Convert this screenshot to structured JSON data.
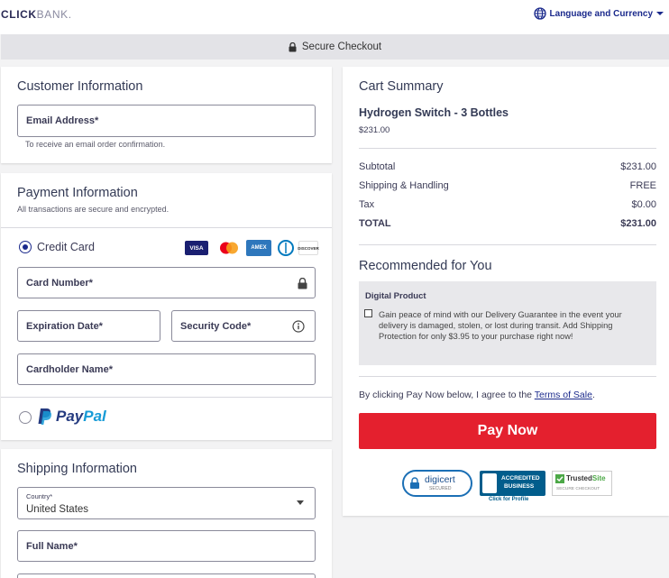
{
  "header": {
    "logo_strong": "CLICK",
    "logo_light": "BANK.",
    "language_label": "Language and Currency"
  },
  "secure_bar": {
    "label": "Secure Checkout"
  },
  "customer": {
    "title": "Customer Information",
    "email_label": "Email Address*",
    "email_hint": "To receive an email order confirmation."
  },
  "payment": {
    "title": "Payment Information",
    "subtitle": "All transactions are secure and encrypted.",
    "credit_card_label": "Credit Card",
    "card_logos": [
      "VISA",
      "MC",
      "AMEX",
      "DINERS",
      "DISCOVER"
    ],
    "card_number_label": "Card Number*",
    "expiration_label": "Expiration Date*",
    "security_code_label": "Security Code*",
    "cardholder_label": "Cardholder Name*",
    "paypal_pay": "Pay",
    "paypal_pal": "Pal"
  },
  "shipping": {
    "title": "Shipping Information",
    "country_label": "Country*",
    "country_value": "United States",
    "full_name_label": "Full Name*"
  },
  "cart": {
    "title": "Cart Summary",
    "product_name": "Hydrogen Switch - 3 Bottles",
    "product_price": "$231.00",
    "lines": [
      {
        "label": "Subtotal",
        "value": "$231.00"
      },
      {
        "label": "Shipping & Handling",
        "value": "FREE"
      },
      {
        "label": "Tax",
        "value": "$0.00"
      }
    ],
    "total_label": "TOTAL",
    "total_value": "$231.00",
    "recommended_title": "Recommended for You",
    "promo_tag": "Digital Product",
    "promo_text": "Gain peace of mind with our Delivery Guarantee in the event your delivery is damaged, stolen, or lost during transit. Add Shipping Protection for only $3.95 to your purchase right now!",
    "terms_prefix": "By clicking Pay Now below, I agree to the ",
    "terms_link": "Terms of Sale",
    "terms_suffix": ".",
    "pay_now": "Pay Now",
    "badges": {
      "digicert": "digicert",
      "digicert_sub": "SECURED",
      "bbb_line1": "ACCREDITED",
      "bbb_line2": "BUSINESS",
      "bbb_link": "Click for Profile",
      "trusted_a": "Trusted",
      "trusted_b": "Site",
      "trusted_sub": "SECURE CHECKOUT"
    }
  },
  "colors": {
    "brand_blue": "#1b2a8c",
    "pay_red": "#e4202e",
    "paypal_dark": "#253b80",
    "paypal_light": "#179bd7"
  }
}
